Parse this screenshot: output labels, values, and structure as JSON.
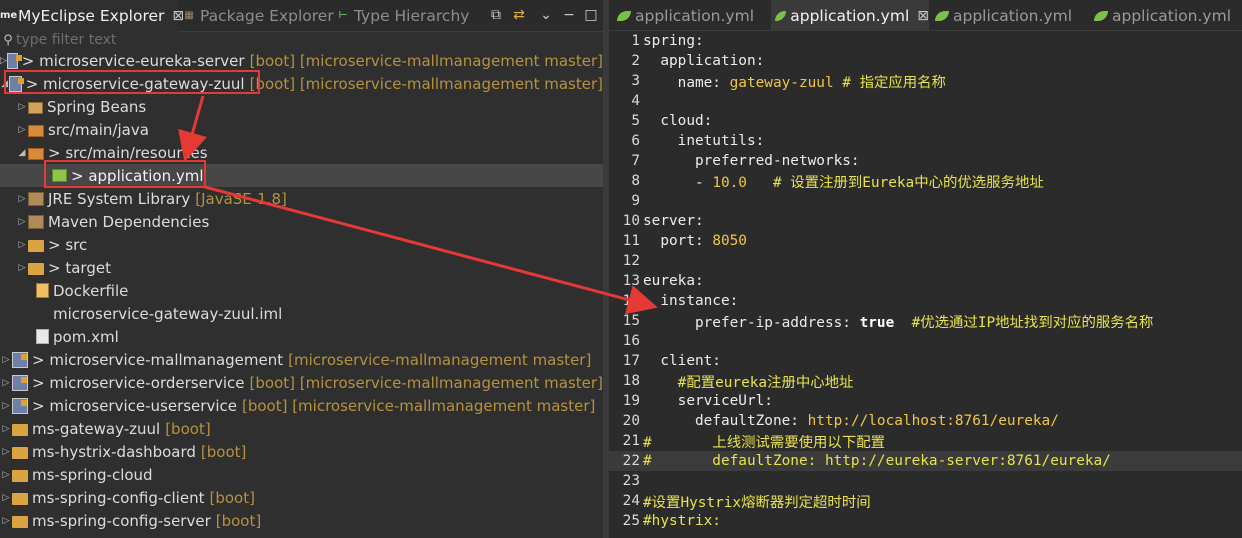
{
  "left": {
    "tabs": [
      {
        "label": "MyEclipse Explorer",
        "icon": "me-icon"
      },
      {
        "label": "Package Explorer",
        "icon": "package-explorer-icon"
      },
      {
        "label": "Type Hierarchy",
        "icon": "type-hierarchy-icon"
      }
    ],
    "filter_placeholder": "type filter text",
    "tree": [
      {
        "label": "> microservice-eureka-server",
        "suffix": "[boot] [microservice-mallmanagement master]",
        "icon": "project-icon"
      },
      {
        "label": "> microservice-gateway-zuul",
        "suffix": "[boot] [microservice-mallmanagement master]",
        "icon": "project-icon"
      },
      {
        "label": "Spring Beans",
        "suffix": "",
        "icon": "spring-beans-icon"
      },
      {
        "label": "src/main/java",
        "suffix": "",
        "icon": "source-folder-icon"
      },
      {
        "label": "> src/main/resources",
        "suffix": "",
        "icon": "source-folder-icon"
      },
      {
        "label": "> application.yml",
        "suffix": "",
        "icon": "yml-file-icon"
      },
      {
        "label": "JRE System Library",
        "suffix": "[JavaSE-1.8]",
        "icon": "library-icon"
      },
      {
        "label": "Maven Dependencies",
        "suffix": "",
        "icon": "library-icon"
      },
      {
        "label": "> src",
        "suffix": "",
        "icon": "folder-icon"
      },
      {
        "label": "> target",
        "suffix": "",
        "icon": "folder-icon"
      },
      {
        "label": "Dockerfile",
        "suffix": "",
        "icon": "docker-file-icon"
      },
      {
        "label": "microservice-gateway-zuul.iml",
        "suffix": "",
        "icon": "file-icon"
      },
      {
        "label": "pom.xml",
        "suffix": "",
        "icon": "xml-file-icon"
      },
      {
        "label": "> microservice-mallmanagement",
        "suffix": "[microservice-mallmanagement master]",
        "icon": "project-icon"
      },
      {
        "label": "> microservice-orderservice",
        "suffix": "[boot] [microservice-mallmanagement master]",
        "icon": "project-icon"
      },
      {
        "label": "> microservice-userservice",
        "suffix": "[boot] [microservice-mallmanagement master]",
        "icon": "project-icon"
      },
      {
        "label": "ms-gateway-zuul",
        "suffix": "[boot]",
        "icon": "folder-icon"
      },
      {
        "label": "ms-hystrix-dashboard",
        "suffix": "[boot]",
        "icon": "folder-icon"
      },
      {
        "label": "ms-spring-cloud",
        "suffix": "",
        "icon": "folder-icon"
      },
      {
        "label": "ms-spring-config-client",
        "suffix": "[boot]",
        "icon": "folder-icon"
      },
      {
        "label": "ms-spring-config-server",
        "suffix": "[boot]",
        "icon": "folder-icon"
      }
    ]
  },
  "right": {
    "tabs": [
      {
        "label": "application.yml"
      },
      {
        "label": "application.yml"
      },
      {
        "label": "application.yml"
      },
      {
        "label": "application.yml"
      }
    ],
    "code": [
      {
        "n": "1",
        "parts": [
          {
            "t": "spring:",
            "c": "key"
          }
        ]
      },
      {
        "n": "2",
        "parts": [
          {
            "t": "  application:",
            "c": "key"
          }
        ]
      },
      {
        "n": "3",
        "parts": [
          {
            "t": "    name: ",
            "c": "key"
          },
          {
            "t": "gateway-zuul",
            "c": "val"
          },
          {
            "t": " # 指定应用名称",
            "c": "cmt"
          }
        ]
      },
      {
        "n": "4",
        "parts": []
      },
      {
        "n": "5",
        "parts": [
          {
            "t": "  cloud:",
            "c": "key"
          }
        ]
      },
      {
        "n": "6",
        "parts": [
          {
            "t": "    inetutils:",
            "c": "key"
          }
        ]
      },
      {
        "n": "7",
        "parts": [
          {
            "t": "      preferred-networks:",
            "c": "key"
          }
        ]
      },
      {
        "n": "8",
        "parts": [
          {
            "t": "      - ",
            "c": "key"
          },
          {
            "t": "10.0",
            "c": "val"
          },
          {
            "t": "   # 设置注册到Eureka中心的优选服务地址",
            "c": "cmt"
          }
        ]
      },
      {
        "n": "9",
        "parts": []
      },
      {
        "n": "10",
        "parts": [
          {
            "t": "server:",
            "c": "key"
          }
        ]
      },
      {
        "n": "11",
        "parts": [
          {
            "t": "  port: ",
            "c": "key"
          },
          {
            "t": "8050",
            "c": "val"
          }
        ]
      },
      {
        "n": "12",
        "parts": []
      },
      {
        "n": "13",
        "parts": [
          {
            "t": "eureka:",
            "c": "key"
          }
        ]
      },
      {
        "n": "14",
        "parts": [
          {
            "t": "  instance:",
            "c": "key"
          }
        ]
      },
      {
        "n": "15",
        "parts": [
          {
            "t": "      prefer-ip-address: ",
            "c": "key"
          },
          {
            "t": "true",
            "c": "bool"
          },
          {
            "t": "  #优选通过IP地址找到对应的服务名称",
            "c": "cmt"
          }
        ]
      },
      {
        "n": "16",
        "parts": []
      },
      {
        "n": "17",
        "parts": [
          {
            "t": "  client:",
            "c": "key"
          }
        ]
      },
      {
        "n": "18",
        "parts": [
          {
            "t": "    #配置eureka注册中心地址",
            "c": "cmt"
          }
        ]
      },
      {
        "n": "19",
        "parts": [
          {
            "t": "    serviceUrl:",
            "c": "key"
          }
        ]
      },
      {
        "n": "20",
        "parts": [
          {
            "t": "      defaultZone: ",
            "c": "key"
          },
          {
            "t": "http://localhost:8761/eureka/",
            "c": "val"
          }
        ]
      },
      {
        "n": "21",
        "parts": [
          {
            "t": "#       上线测试需要使用以下配置",
            "c": "cmt"
          }
        ]
      },
      {
        "n": "22",
        "parts": [
          {
            "t": "#       defaultZone: http://eureka-server:8761/eureka/",
            "c": "cmt"
          }
        ]
      },
      {
        "n": "23",
        "parts": []
      },
      {
        "n": "24",
        "parts": [
          {
            "t": "#设置Hystrix熔断器判定超时时间",
            "c": "cmt"
          }
        ]
      },
      {
        "n": "25",
        "parts": [
          {
            "t": "#hystrix:",
            "c": "cmt"
          }
        ]
      }
    ]
  },
  "colors": {
    "annotation_red": "#e53935",
    "string_value": "#f0c648",
    "comment": "#e8e34a",
    "boot_suffix": "#b6923e"
  }
}
